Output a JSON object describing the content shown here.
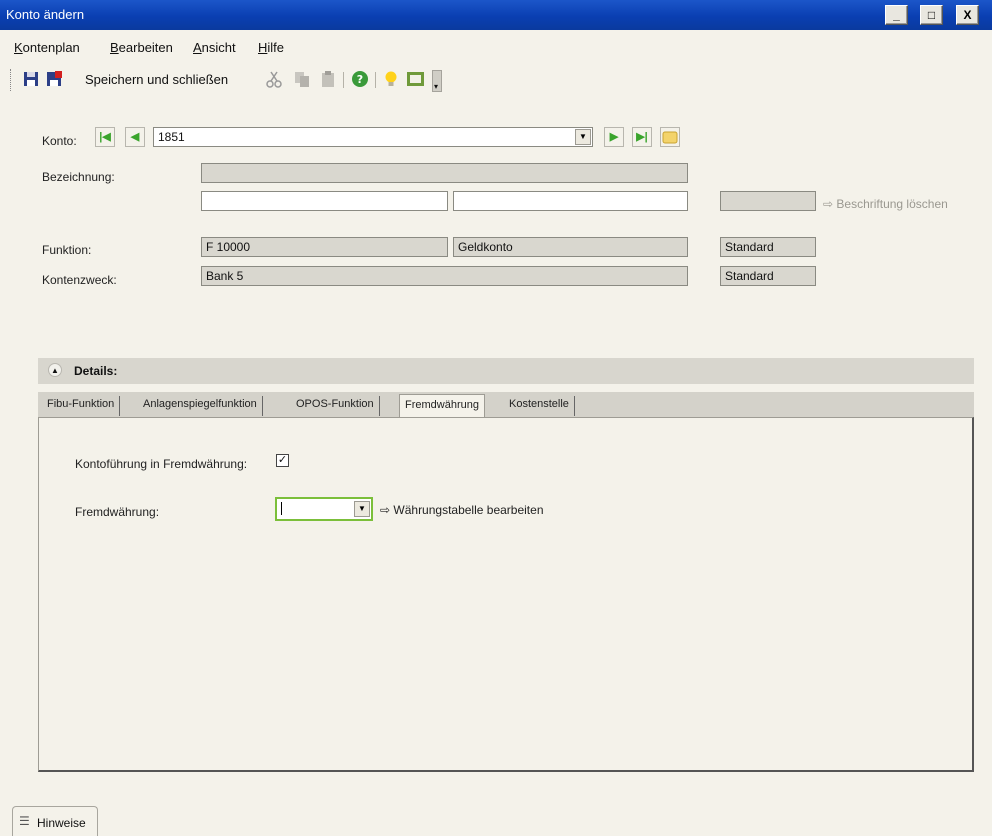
{
  "window": {
    "title": "Konto ändern",
    "controls": {
      "minimize": "_",
      "maximize": "□",
      "close": "X"
    }
  },
  "menu": {
    "items": [
      {
        "accel": "K",
        "rest": "ontenplan"
      },
      {
        "accel": "B",
        "rest": "earbeiten"
      },
      {
        "accel": "A",
        "rest": "nsicht"
      },
      {
        "accel": "H",
        "rest": "ilfe"
      }
    ]
  },
  "toolbar": {
    "save_close_label": "Speichern und schließen"
  },
  "form": {
    "konto_label": "Konto:",
    "konto_value": "1851",
    "bezeichnung_label": "Bezeichnung:",
    "bezeichnung_value": "",
    "bezeichnung_alt1": "",
    "bezeichnung_alt2": "",
    "beschriftung_value": "",
    "beschriftung_link": "⇨ Beschriftung löschen",
    "funktion_label": "Funktion:",
    "funktion_code": "F 10000",
    "funktion_name": "Geldkonto",
    "funktion_type": "Standard",
    "kontenzweck_label": "Kontenzweck:",
    "kontenzweck_value": "Bank 5",
    "kontenzweck_type": "Standard"
  },
  "details": {
    "title": "Details:",
    "tabs": [
      {
        "label": "Fibu-Funktion"
      },
      {
        "label": "Anlagenspiegelfunktion"
      },
      {
        "label": "OPOS-Funktion"
      },
      {
        "label": "Fremdwährung"
      },
      {
        "label": "Kostenstelle"
      }
    ],
    "active_tab": "Fremdwährung",
    "kontofuehrung_label": "Kontoführung in Fremdwährung:",
    "kontofuehrung_checked": true,
    "fremdwaehrung_label": "Fremdwährung:",
    "fremdwaehrung_value": "",
    "waehrungstabelle_link": "⇨ Währungstabelle bearbeiten"
  },
  "bottom": {
    "hinweise_label": "Hinweise"
  }
}
